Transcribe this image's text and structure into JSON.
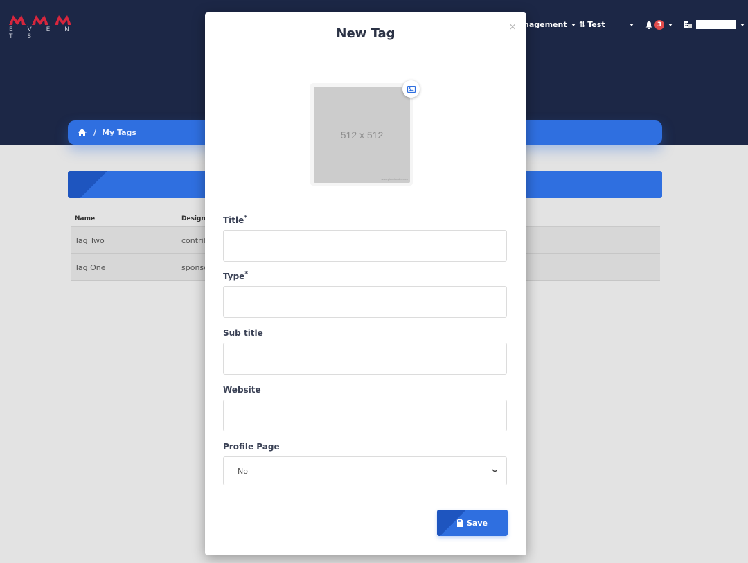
{
  "app": {
    "logo_subtext": "E V E N T S",
    "logo_color": "#d7263d"
  },
  "nav": {
    "management_label": "nagement",
    "test_label": "Test",
    "notifications_count": "3"
  },
  "breadcrumb": {
    "current": "My Tags"
  },
  "table": {
    "columns": [
      "Name",
      "Designa"
    ],
    "rows": [
      {
        "name": "Tag Two",
        "designation": "contrib"
      },
      {
        "name": "Tag One",
        "designation": "sponso"
      }
    ]
  },
  "modal": {
    "title": "New Tag",
    "close_glyph": "×",
    "image_placeholder": "512 x 512",
    "image_caption": "www.placeholder.com",
    "fields": {
      "title": {
        "label": "Title",
        "required_mark": "*",
        "value": ""
      },
      "type": {
        "label": "Type",
        "required_mark": "*",
        "value": ""
      },
      "subtitle": {
        "label": "Sub title",
        "value": ""
      },
      "website": {
        "label": "Website",
        "value": ""
      },
      "profile_page": {
        "label": "Profile Page",
        "selected": "No"
      }
    },
    "save_label": "Save"
  },
  "colors": {
    "header_bg": "#1c2746",
    "accent": "#2f6fe0",
    "badge": "#e14b4b"
  }
}
